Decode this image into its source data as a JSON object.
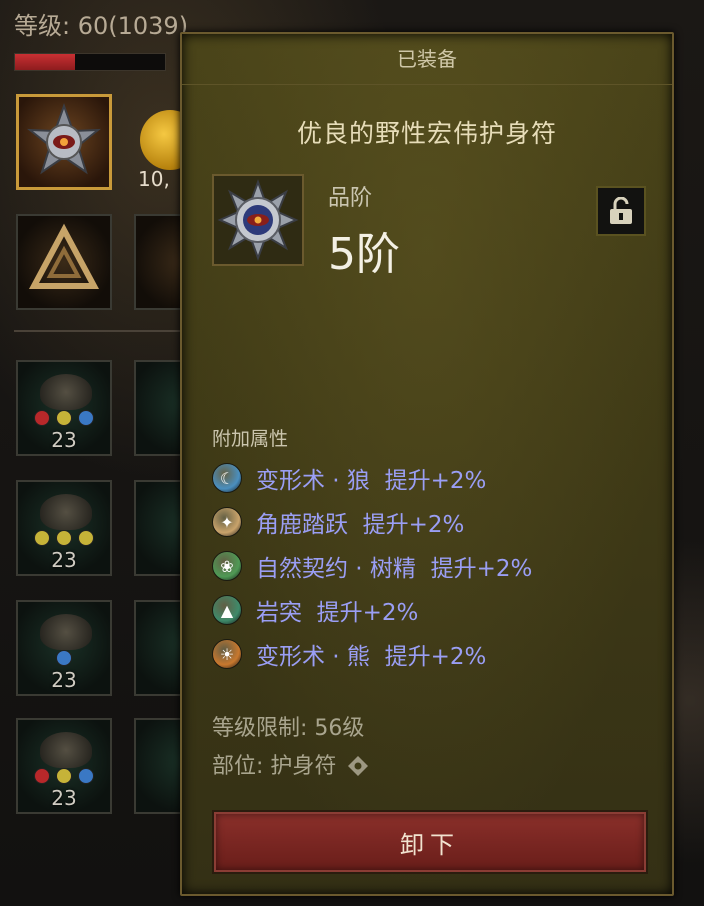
{
  "background": {
    "level_label": "等级: 60(1039)",
    "xp_fraction": 0.4,
    "currency_count": "10,",
    "slot_counts": [
      "23",
      "23",
      "23",
      "23"
    ]
  },
  "popup": {
    "header": "已装备",
    "item_name": "优良的野性宏伟护身符",
    "tier_label": "品阶",
    "tier_value": "5阶",
    "lock_icon": "unlock-icon",
    "attributes_heading": "附加属性",
    "attributes": [
      {
        "icon": "werewolf-skill-icon",
        "name": "变形术 · 狼",
        "bonus": "提升+2%",
        "color": "#4a8fbf"
      },
      {
        "icon": "stag-leap-skill-icon",
        "name": "角鹿踏跃",
        "bonus": "提升+2%",
        "color": "#c9a36b"
      },
      {
        "icon": "treant-pact-skill-icon",
        "name": "自然契约 · 树精",
        "bonus": "提升+2%",
        "color": "#4f9a55"
      },
      {
        "icon": "rock-spike-skill-icon",
        "name": "岩突",
        "bonus": "提升+2%",
        "color": "#3f8a6a"
      },
      {
        "icon": "werebear-skill-icon",
        "name": "变形术 · 熊",
        "bonus": "提升+2%",
        "color": "#c8782e"
      }
    ],
    "level_requirement": "等级限制: 56级",
    "slot_label": "部位: 护身符",
    "unequip_button": "卸下"
  },
  "colors": {
    "attribute_text": "#9a9ef4",
    "button_red": "#8a2f2a",
    "popup_bg": "#433e17"
  }
}
